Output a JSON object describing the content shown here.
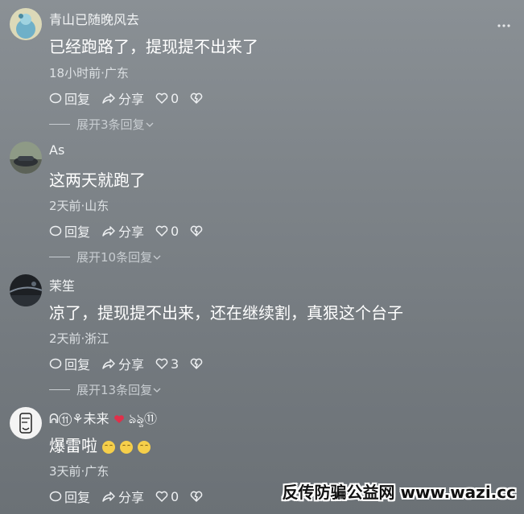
{
  "comments": [
    {
      "username": "青山已随晚风去",
      "text": "已经跑路了，提现提不出来了",
      "meta": "18小时前·广东",
      "reply_label": "回复",
      "share_label": "分享",
      "likes": "0",
      "expand_label": "展开3条回复"
    },
    {
      "username": "As",
      "text": "这两天就跑了",
      "meta": "2天前·山东",
      "reply_label": "回复",
      "share_label": "分享",
      "likes": "0",
      "expand_label": "展开10条回复"
    },
    {
      "username": "茉笙",
      "text": "凉了，提现提不出来，还在继续割，真狠这个台子",
      "meta": "2天前·浙江",
      "reply_label": "回复",
      "share_label": "分享",
      "likes": "3",
      "expand_label": "展开13条回复"
    },
    {
      "username": "ᕱ⑪⚘未来",
      "username_suffix": "ঌৡ⑪",
      "text": "爆雷啦",
      "meta": "3天前·广东",
      "reply_label": "回复",
      "share_label": "分享",
      "likes": "0"
    }
  ],
  "watermark": "反传防骗公益网 www.wazi.cc",
  "colors": {
    "background": "#7e8489",
    "text": "#ffffff",
    "heart": "#e0304a"
  }
}
